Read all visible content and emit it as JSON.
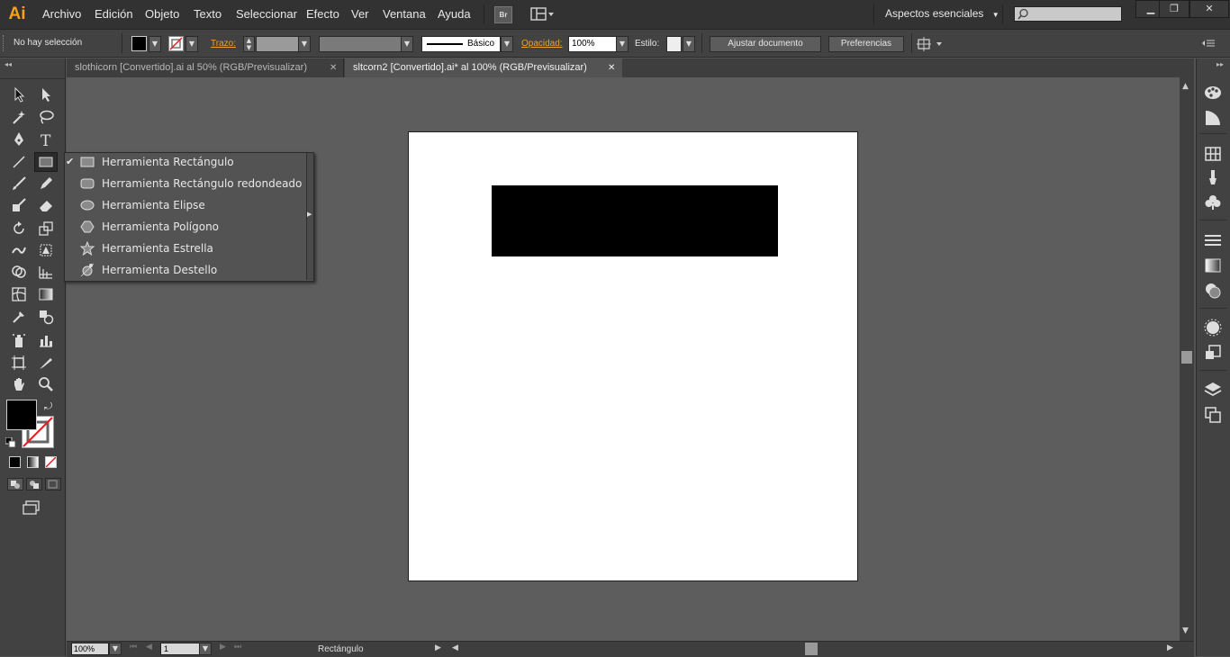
{
  "app": {
    "logo": "Ai"
  },
  "menubar": {
    "items": [
      "Archivo",
      "Edición",
      "Objeto",
      "Texto",
      "Seleccionar",
      "Efecto",
      "Ver",
      "Ventana",
      "Ayuda"
    ],
    "bridge_label": "Br",
    "workspace": "Aspectos esenciales",
    "search_placeholder": ""
  },
  "controlbar": {
    "selection_status": "No hay selección",
    "stroke_label": "Trazo:",
    "stroke_style": "Básico",
    "opacity_label": "Opacidad:",
    "opacity_value": "100%",
    "style_label": "Estilo:",
    "adjust_button": "Ajustar documento",
    "prefs_button": "Preferencias"
  },
  "tabs": [
    {
      "label": "slothicorn [Convertido].ai al 50% (RGB/Previsualizar)",
      "active": false
    },
    {
      "label": "sltcorn2 [Convertido].ai* al 100% (RGB/Previsualizar)",
      "active": true
    }
  ],
  "flyout": {
    "items": [
      {
        "label": "Herramienta Rectángulo",
        "checked": true,
        "icon": "rectangle-icon"
      },
      {
        "label": "Herramienta Rectángulo redondeado",
        "checked": false,
        "icon": "rounded-rectangle-icon"
      },
      {
        "label": "Herramienta Elipse",
        "checked": false,
        "icon": "ellipse-icon"
      },
      {
        "label": "Herramienta Polígono",
        "checked": false,
        "icon": "polygon-icon"
      },
      {
        "label": "Herramienta Estrella",
        "checked": false,
        "icon": "star-icon"
      },
      {
        "label": "Herramienta Destello",
        "checked": false,
        "icon": "flare-icon"
      }
    ]
  },
  "status": {
    "zoom": "100%",
    "artboard_number": "1",
    "current_tool": "Rectángulo"
  },
  "colors": {
    "accent": "#f7a21b",
    "fill": "#000000",
    "artboard": "#ffffff"
  }
}
